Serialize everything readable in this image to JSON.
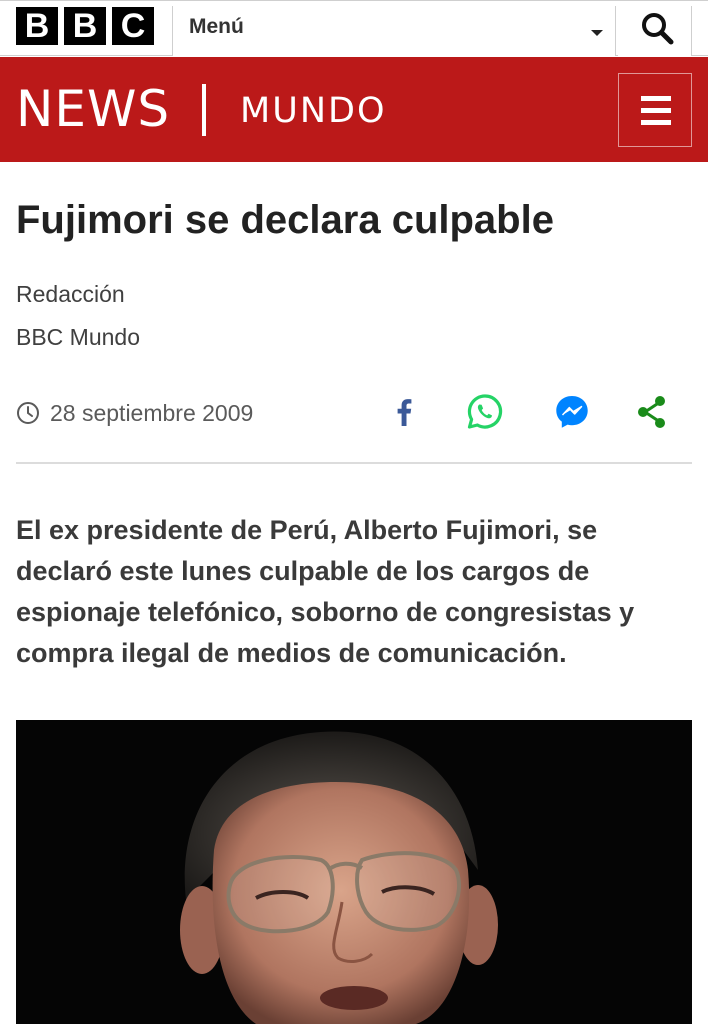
{
  "topbar": {
    "logo_letters": [
      "B",
      "B",
      "C"
    ],
    "menu_label": "Menú",
    "search_icon": "search-icon"
  },
  "newsbar": {
    "news": "NEWS",
    "section": "MUNDO",
    "menu_icon": "hamburger-icon",
    "brand_color": "#bb1919"
  },
  "article": {
    "headline": "Fujimori se declara culpable",
    "byline": {
      "name": "Redacción",
      "org": "BBC Mundo"
    },
    "date": "28 septiembre 2009",
    "share_icons": [
      "facebook-icon",
      "whatsapp-icon",
      "messenger-icon",
      "share-icon"
    ],
    "intro": "El ex presidente de Perú, Alberto Fujimori, se declaró este lunes culpable de los cargos de espionaje telefónico, soborno de congresistas y compra ilegal de medios de comunicación."
  },
  "colors": {
    "facebook": "#3b5998",
    "whatsapp": "#25d366",
    "messenger": "#0084ff",
    "share": "#1a8b1a"
  }
}
